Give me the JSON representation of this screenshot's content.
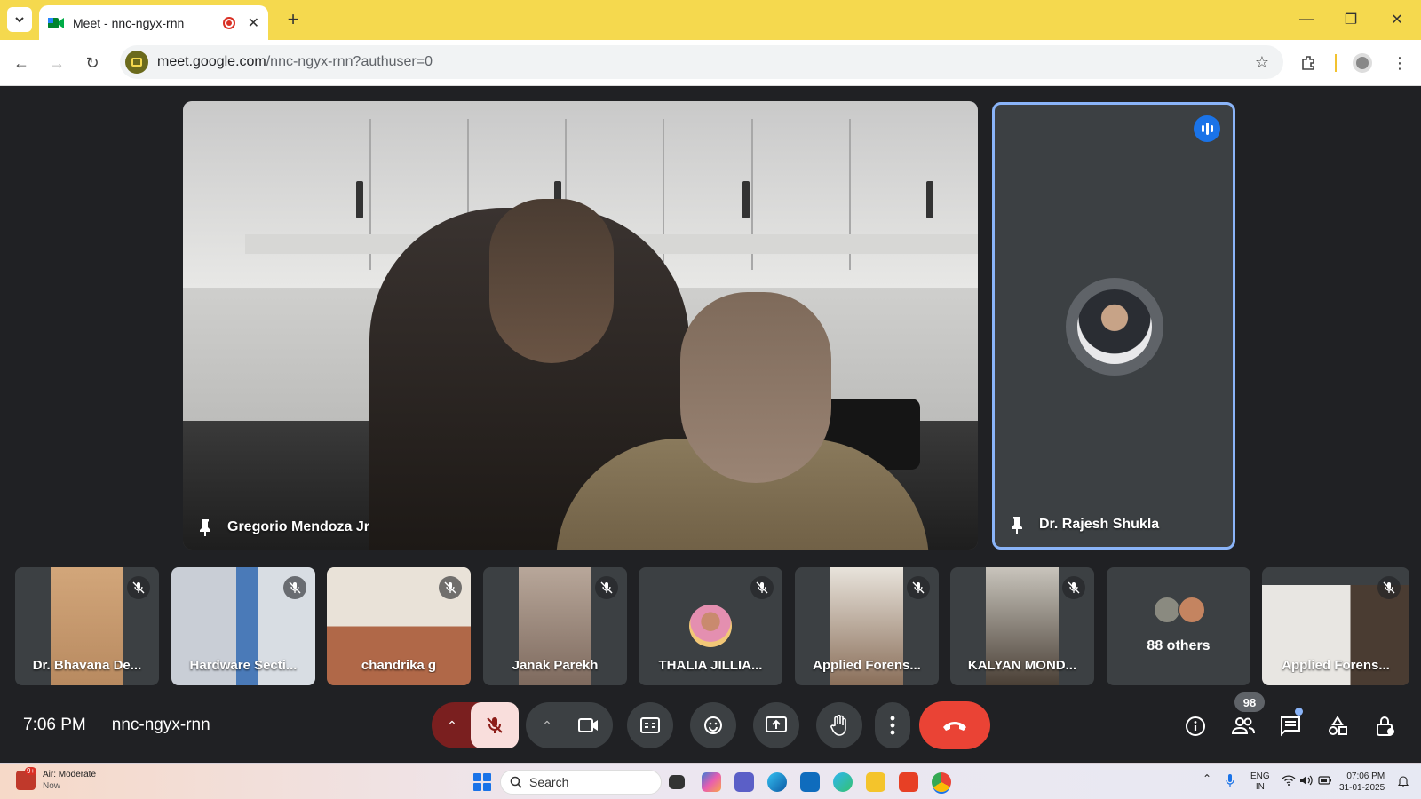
{
  "browser": {
    "tab_title": "Meet - nnc-ngyx-rnn",
    "url_host": "meet.google.com",
    "url_path": "/nnc-ngyx-rnn?authuser=0"
  },
  "main_stage": {
    "primary": {
      "name": "Gregorio Mendoza Jr"
    },
    "secondary": {
      "name": "Dr. Rajesh Shukla",
      "speaking": true
    }
  },
  "filmstrip": [
    {
      "name": "Dr. Bhavana De...",
      "muted": true,
      "bg": "#c8a07a"
    },
    {
      "name": "Hardware Secti...",
      "muted": true,
      "bg": "#8fa3b8"
    },
    {
      "name": "chandrika g",
      "muted": true,
      "bg": "#b8866a"
    },
    {
      "name": "Janak Parekh",
      "muted": true,
      "bg": "#9a8678"
    },
    {
      "name": "THALIA JILLIA...",
      "muted": true,
      "bg": "#3c4043"
    },
    {
      "name": "Applied Forens...",
      "muted": true,
      "bg": "#a89a84"
    },
    {
      "name": "KALYAN MOND...",
      "muted": true,
      "bg": "#8e8e86"
    },
    {
      "name": "88 others",
      "muted": false,
      "bg": "#3c4043"
    },
    {
      "name": "Applied Forens...",
      "muted": true,
      "bg": "#b09e8e"
    }
  ],
  "controls": {
    "time": "7:06 PM",
    "meeting_code": "nnc-ngyx-rnn",
    "people_count": "98"
  },
  "taskbar": {
    "weather_title": "Air: Moderate",
    "weather_sub": "Now",
    "weather_badge": "9+",
    "search_placeholder": "Search",
    "lang_top": "ENG",
    "lang_bottom": "IN",
    "clock_time": "07:06 PM",
    "clock_date": "31-01-2025"
  },
  "colors": {
    "tab_strip": "#f5d94e",
    "hangup": "#ea4335",
    "active_border": "#8ab4f8",
    "speaking": "#1a73e8",
    "mic_off_bg": "#f9dedc"
  }
}
